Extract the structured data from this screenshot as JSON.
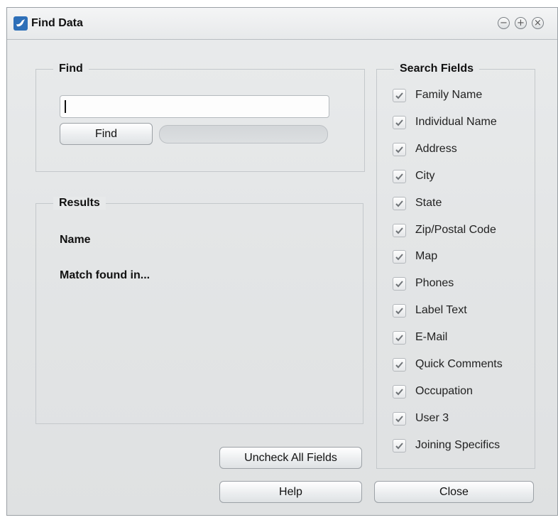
{
  "window": {
    "title": "Find Data",
    "controls": [
      "minimize-icon",
      "maximize-icon",
      "close-icon"
    ]
  },
  "find_group": {
    "label": "Find",
    "input_value": "",
    "find_button": "Find",
    "progress": 0
  },
  "results_group": {
    "label": "Results",
    "name_label": "Name",
    "match_label": "Match found in..."
  },
  "search_fields": {
    "label": "Search Fields",
    "items": [
      {
        "label": "Family Name",
        "checked": true
      },
      {
        "label": "Individual Name",
        "checked": true
      },
      {
        "label": "Address",
        "checked": true
      },
      {
        "label": "City",
        "checked": true
      },
      {
        "label": "State",
        "checked": true
      },
      {
        "label": "Zip/Postal Code",
        "checked": true
      },
      {
        "label": "Map",
        "checked": true
      },
      {
        "label": "Phones",
        "checked": true
      },
      {
        "label": "Label Text",
        "checked": true
      },
      {
        "label": "E-Mail",
        "checked": true
      },
      {
        "label": "Quick Comments",
        "checked": true
      },
      {
        "label": "Occupation",
        "checked": true
      },
      {
        "label": "User 3",
        "checked": true
      },
      {
        "label": "Joining Specifics",
        "checked": true
      }
    ]
  },
  "buttons": {
    "uncheck_all": "Uncheck All Fields",
    "help": "Help",
    "close": "Close"
  }
}
